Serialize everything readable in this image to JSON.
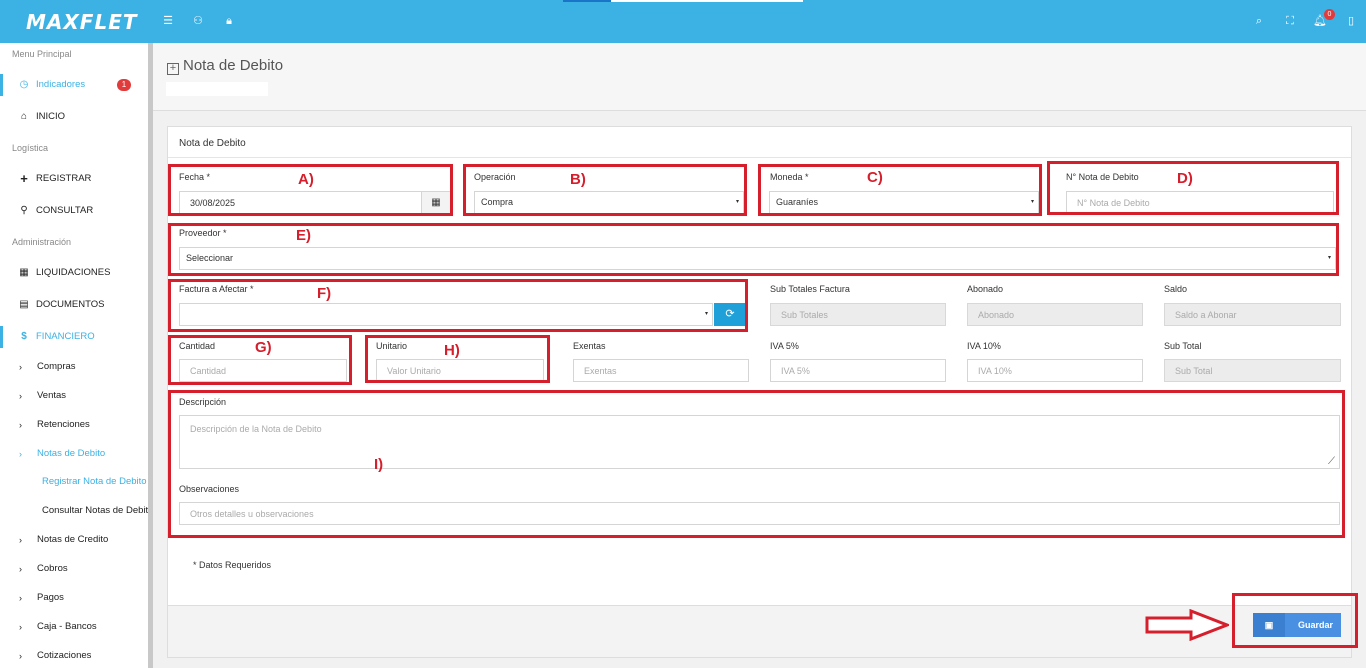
{
  "app": {
    "logo": "MAXFLET"
  },
  "topbar": {
    "menu_icon": "☰",
    "user_icon": "⚇",
    "lock_icon": "🔒︎",
    "search_icon": "⌕",
    "fullscreen_icon": "⛶",
    "bell_icon": "🔔︎",
    "notification_count": "0",
    "sidebar_toggle_icon": "▯",
    "loading_progress": 0.2
  },
  "sidebar": {
    "section_main": "Menu Principal",
    "indicadores": {
      "icon": "◷",
      "label": "Indicadores",
      "badge": "1"
    },
    "inicio": {
      "icon": "⌂",
      "label": "INICIO"
    },
    "section_logistica": "Logística",
    "registrar": {
      "icon": "+",
      "label": "REGISTRAR"
    },
    "consultar": {
      "icon": "⚲",
      "label": "CONSULTAR"
    },
    "section_admin": "Administración",
    "liquidaciones": {
      "icon": "▦",
      "label": "LIQUIDACIONES"
    },
    "documentos": {
      "icon": "▤",
      "label": "DOCUMENTOS"
    },
    "financiero": {
      "icon": "$",
      "label": "FINANCIERO"
    },
    "chevron": "›",
    "sub": [
      "Compras",
      "Ventas",
      "Retenciones",
      "Notas de Debito",
      "Notas de Credito",
      "Cobros",
      "Pagos",
      "Caja - Bancos",
      "Cotizaciones"
    ],
    "notas_debito_sub": [
      "Registrar Nota de Debito",
      "Consultar Notas de Debito"
    ]
  },
  "page": {
    "title_icon": "+",
    "title": "Nota de Debito"
  },
  "form": {
    "card_title": "Nota de Debito",
    "fecha": {
      "label": "Fecha *",
      "value": "30/08/2025",
      "calendar_icon": "▦"
    },
    "operacion": {
      "label": "Operación",
      "value": "Compra"
    },
    "moneda": {
      "label": "Moneda *",
      "value": "Guaraníes"
    },
    "nro_nota": {
      "label": "N° Nota de Debito",
      "placeholder": "N° Nota de Debito"
    },
    "proveedor": {
      "label": "Proveedor *",
      "value": "Seleccionar"
    },
    "factura": {
      "label": "Factura a Afectar *",
      "value": "",
      "refresh_icon": "⟳"
    },
    "sub_totales_factura": {
      "label": "Sub Totales Factura",
      "placeholder": "Sub Totales"
    },
    "abonado": {
      "label": "Abonado",
      "placeholder": "Abonado"
    },
    "saldo": {
      "label": "Saldo",
      "placeholder": "Saldo a Abonar"
    },
    "cantidad": {
      "label": "Cantidad",
      "placeholder": "Cantidad"
    },
    "unitario": {
      "label": "Unitario",
      "placeholder": "Valor Unitario"
    },
    "exentas": {
      "label": "Exentas",
      "placeholder": "Exentas"
    },
    "iva5": {
      "label": "IVA 5%",
      "placeholder": "IVA 5%"
    },
    "iva10": {
      "label": "IVA 10%",
      "placeholder": "IVA 10%"
    },
    "sub_total": {
      "label": "Sub Total",
      "placeholder": "Sub Total"
    },
    "descripcion": {
      "label": "Descripción",
      "placeholder": "Descripción de la Nota de Debito"
    },
    "observaciones": {
      "label": "Observaciones",
      "placeholder": "Otros detalles u observaciones"
    },
    "required_note": "* Datos Requeridos",
    "caret": "▾",
    "resize_icon": "⟋"
  },
  "footer": {
    "save_icon": "▣",
    "save_label": "Guardar"
  },
  "annotations": {
    "color": "#d61f2c",
    "letters": [
      "A)",
      "B)",
      "C)",
      "D)",
      "E)",
      "F)",
      "G)",
      "H)",
      "I)"
    ]
  }
}
